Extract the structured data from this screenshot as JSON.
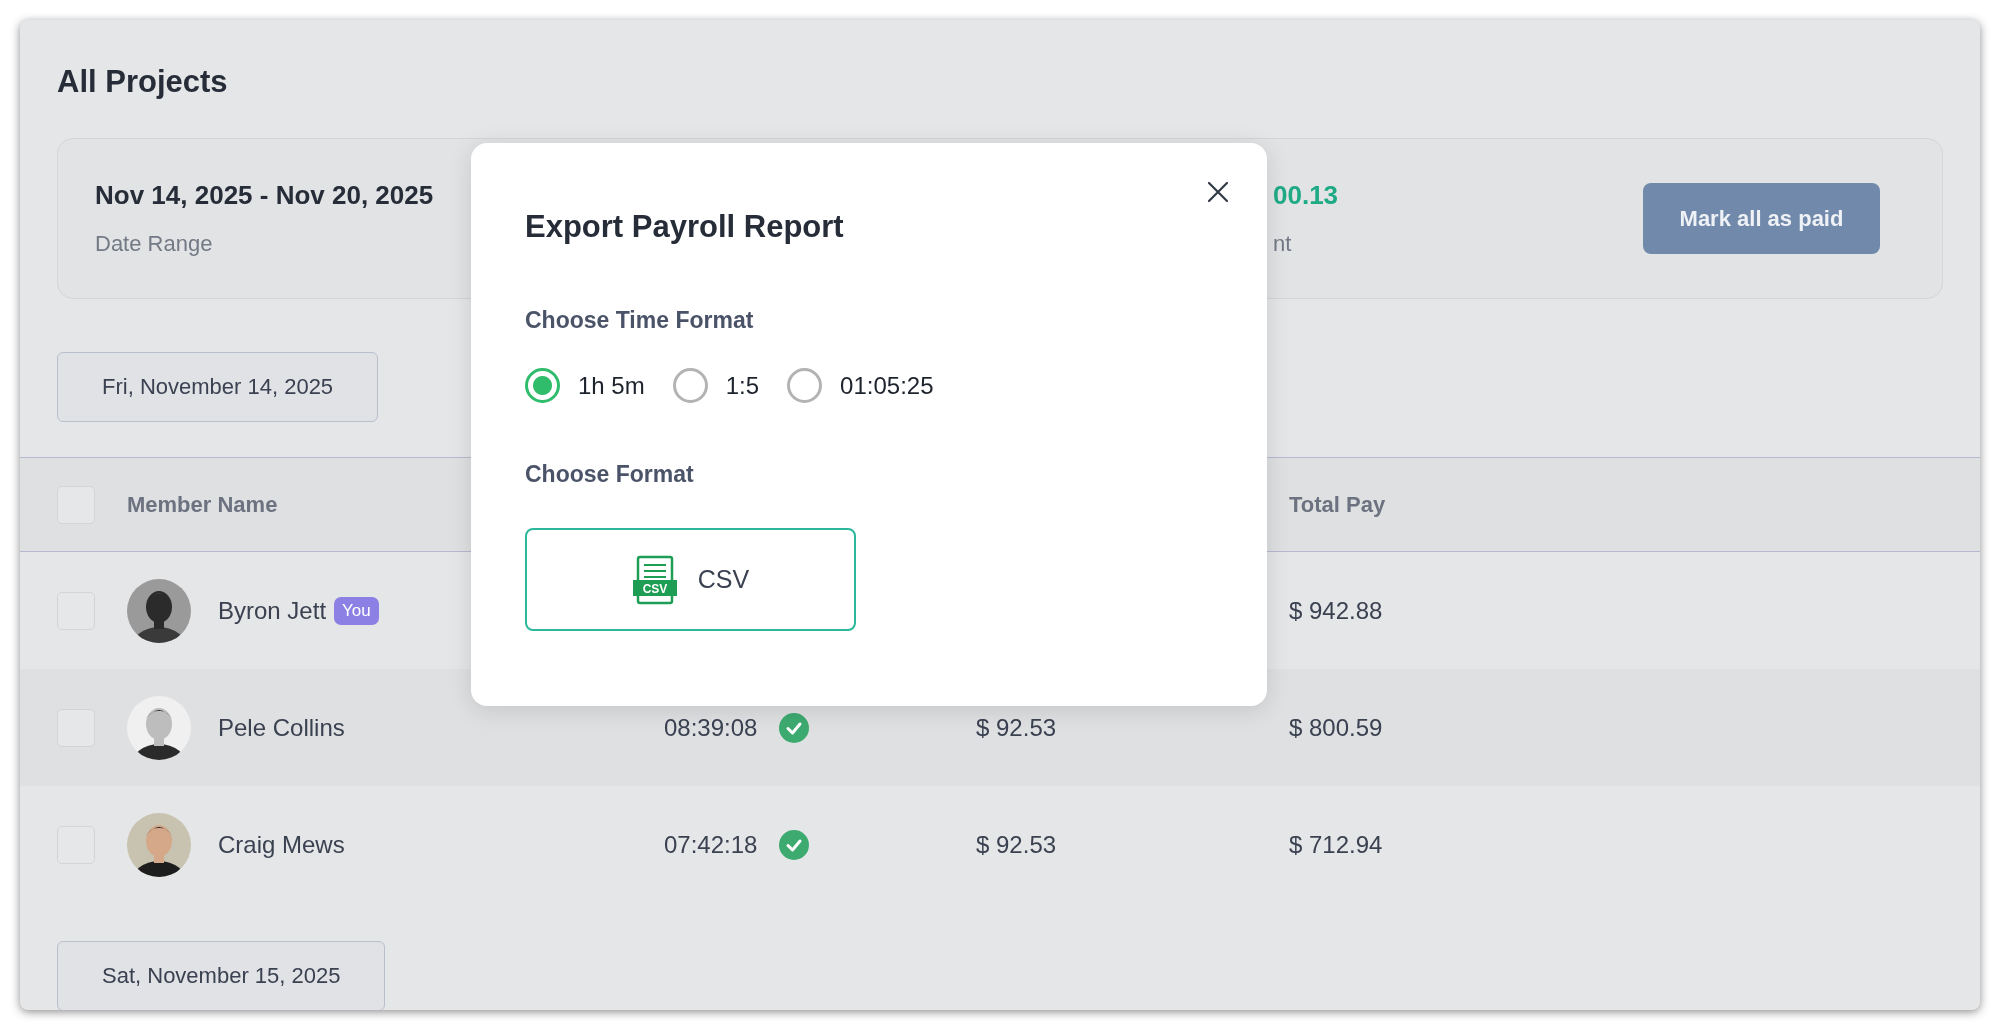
{
  "page": {
    "title": "All Projects"
  },
  "summary": {
    "date_range": "Nov 14, 2025 - Nov 20, 2025",
    "date_range_label": "Date Range",
    "amount": "00.13",
    "amount_label": "nt",
    "button": "Mark all as paid"
  },
  "day_header": "Fri, November 14, 2025",
  "table": {
    "header": {
      "checked": false,
      "member_name": "Member Name",
      "total_pay": "Total Pay"
    },
    "rows": [
      {
        "checked": false,
        "name": "Byron Jett",
        "badge": "You",
        "total_pay": "$ 942.88"
      },
      {
        "checked": false,
        "name": "Pele Collins",
        "time": "08:39:08",
        "approved": true,
        "rate": "$ 92.53",
        "total_pay": "$ 800.59"
      },
      {
        "checked": false,
        "name": "Craig Mews",
        "time": "07:42:18",
        "approved": true,
        "rate": "$ 92.53",
        "total_pay": "$ 712.94"
      }
    ]
  },
  "next_day_header": "Sat, November 15, 2025",
  "modal": {
    "title": "Export Payroll Report",
    "time_format_label": "Choose Time Format",
    "time_formats": [
      {
        "label": "1h 5m",
        "selected": true
      },
      {
        "label": "1:5",
        "selected": false
      },
      {
        "label": "01:05:25",
        "selected": false
      }
    ],
    "format_label": "Choose Format",
    "formats": [
      {
        "label": "CSV",
        "icon_text": "CSV"
      }
    ]
  }
}
